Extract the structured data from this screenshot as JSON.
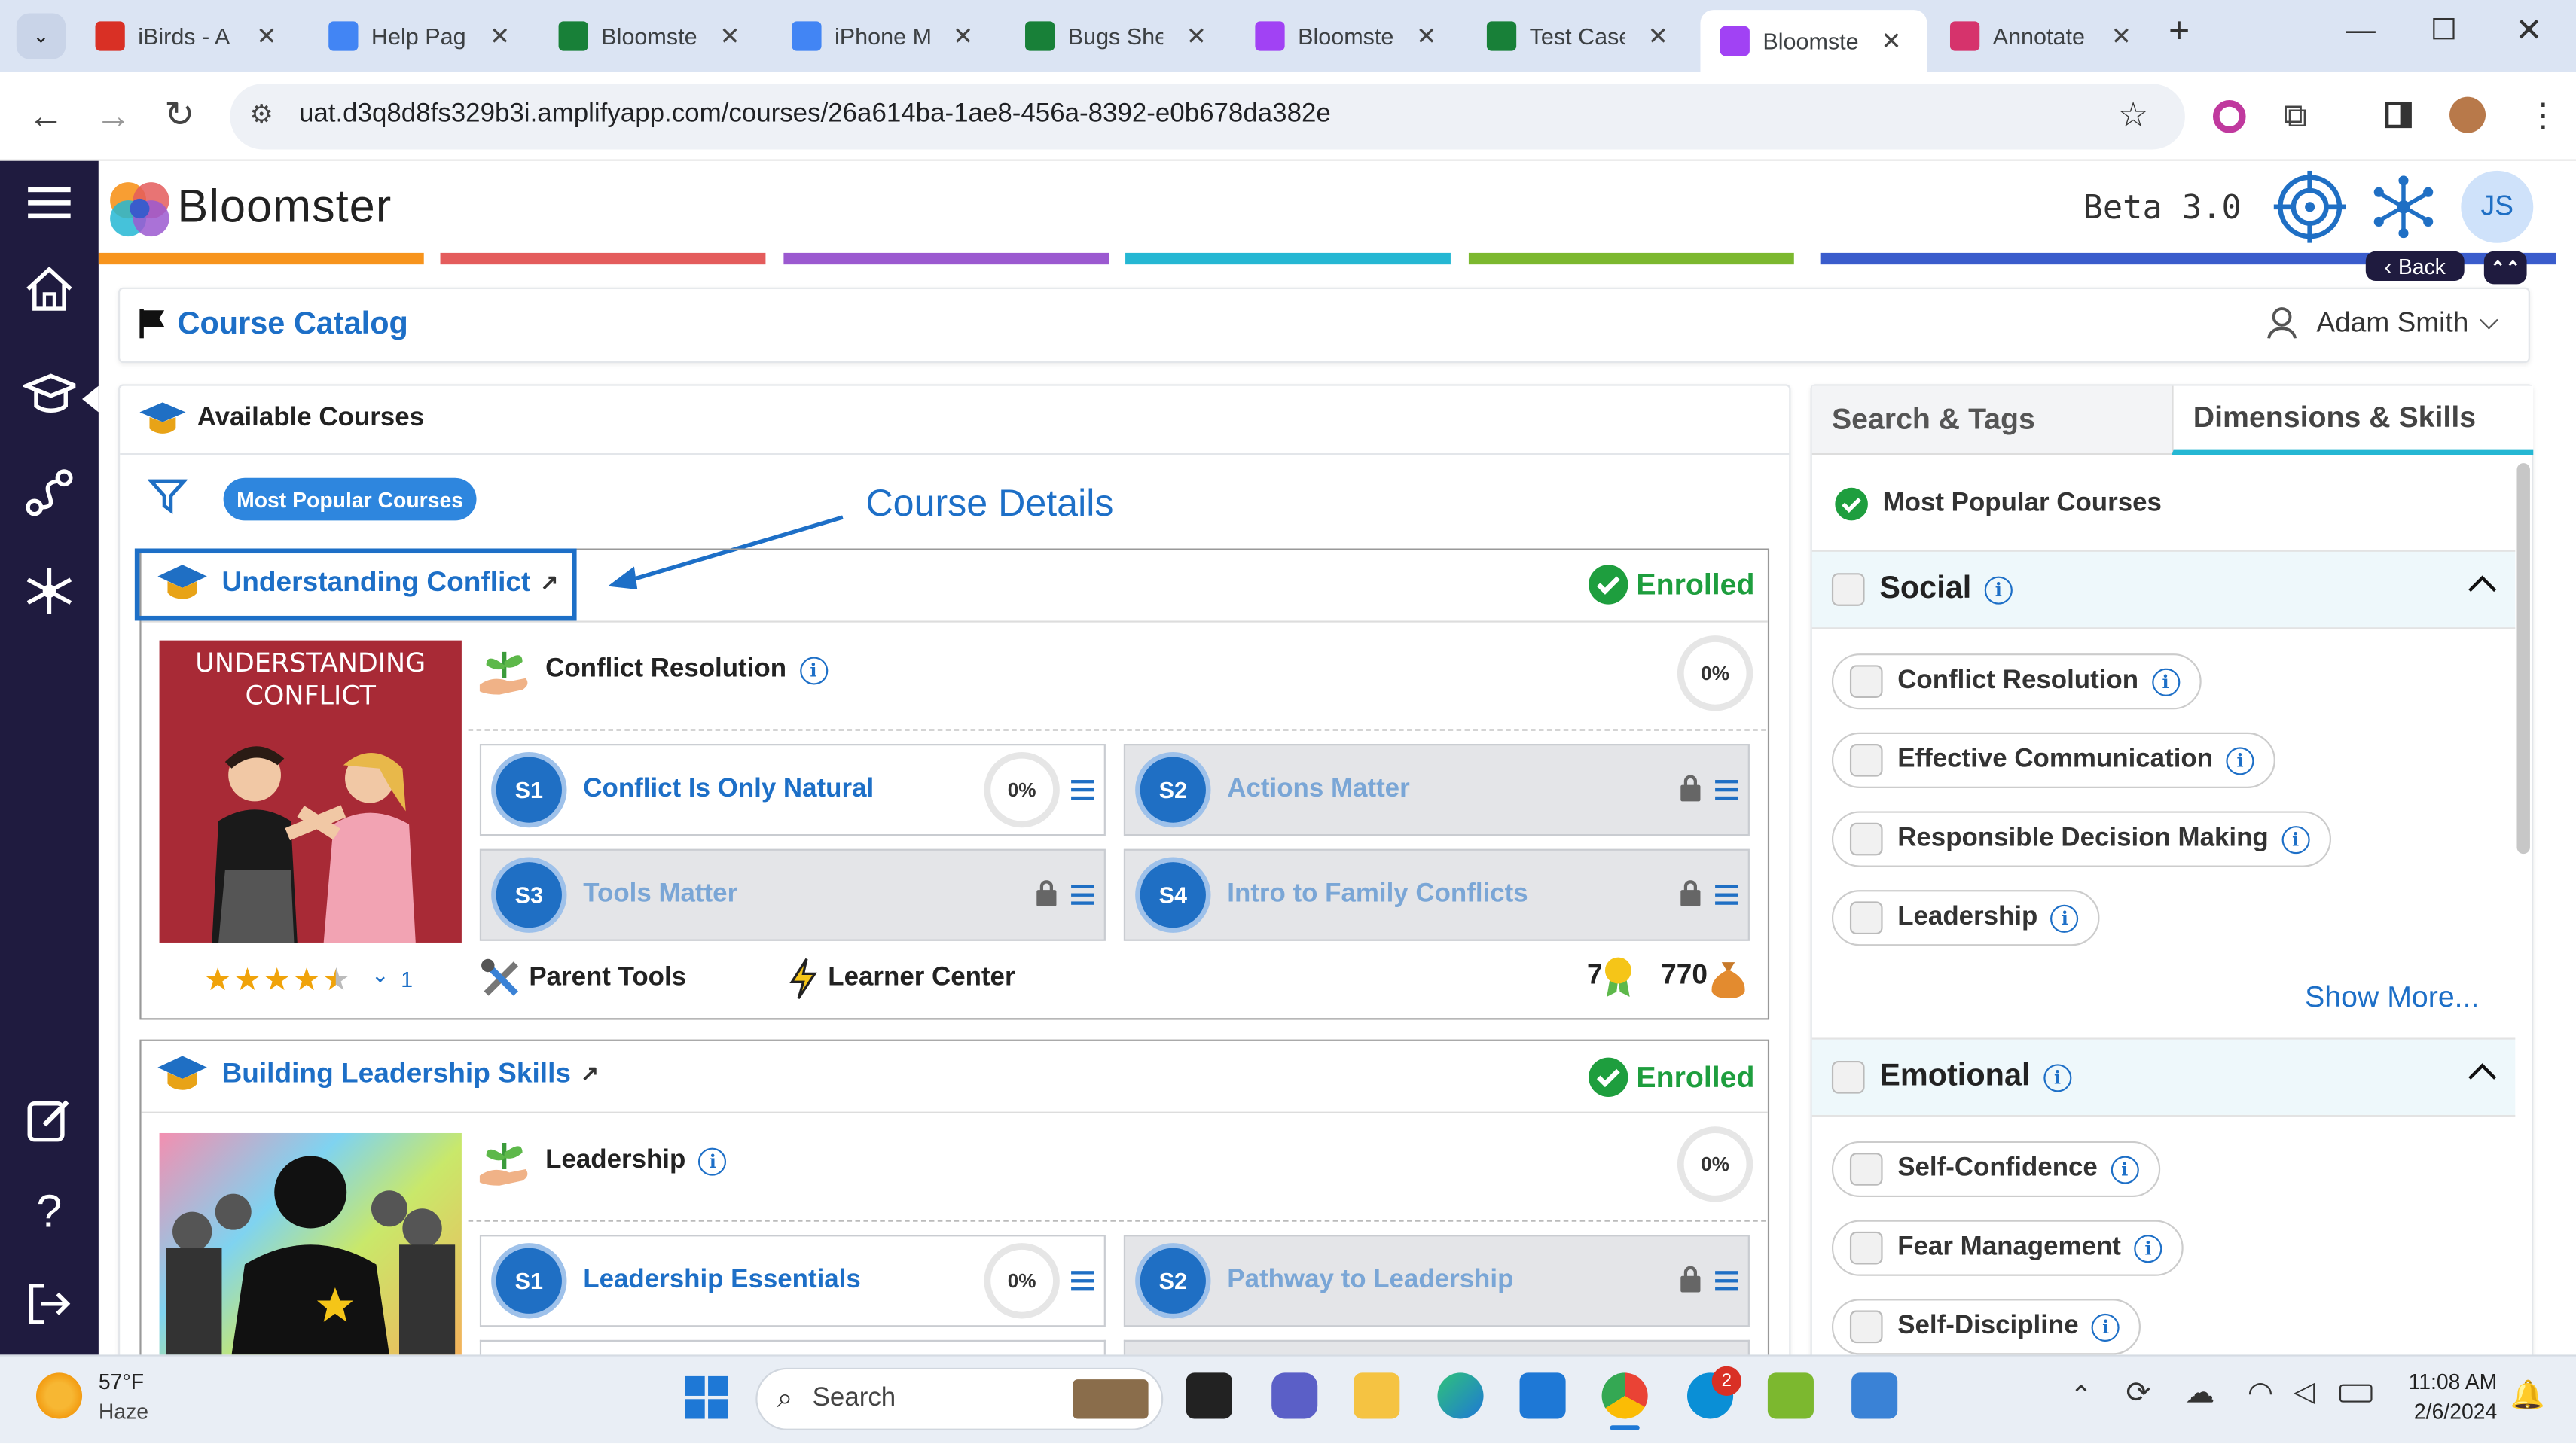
{
  "browser": {
    "tabs": [
      {
        "label": "iBirds - A",
        "color": "#d93025"
      },
      {
        "label": "Help Page",
        "color": "#4285f4"
      },
      {
        "label": "Bloomster",
        "color": "#188038"
      },
      {
        "label": "iPhone M",
        "color": "#4285f4"
      },
      {
        "label": "Bugs Shee",
        "color": "#188038"
      },
      {
        "label": "Bloomster",
        "color": "#a142f4"
      },
      {
        "label": "Test Case",
        "color": "#188038"
      },
      {
        "label": "Bloomster",
        "color": "#a142f4"
      },
      {
        "label": "Annotate",
        "color": "#d6336c"
      }
    ],
    "active_tab": 7,
    "url": "uat.d3q8d8fs329b3i.amplifyapp.com/courses/26a614ba-1ae8-456a-8392-e0b678da382e"
  },
  "app": {
    "brand": "Bloomster",
    "version": "Beta 3.0",
    "avatar_initials": "JS",
    "back_label": "Back",
    "color_bar": [
      "#f7941d",
      "#e45c5c",
      "#9b59d0",
      "#25b7d3",
      "#7cb82f",
      "#3a5ccc"
    ]
  },
  "catalog": {
    "title": "Course Catalog",
    "user": "Adam Smith",
    "available_title": "Available Courses",
    "filter_pill": "Most Popular Courses",
    "annotation": "Course Details"
  },
  "courses": [
    {
      "title": "Understanding Conflict",
      "status": "Enrolled",
      "cover_text": "UNDERSTANDING CONFLICT",
      "skill": "Conflict Resolution",
      "progress": "0%",
      "rating": 4.5,
      "rating_count": "1",
      "parent_tools": "Parent Tools",
      "learner_center": "Learner Center",
      "medals": "7",
      "coins": "770",
      "sessions": [
        {
          "code": "S1",
          "name": "Conflict Is Only Natural",
          "progress": "0%",
          "locked": false
        },
        {
          "code": "S2",
          "name": "Actions Matter",
          "locked": true
        },
        {
          "code": "S3",
          "name": "Tools Matter",
          "locked": true
        },
        {
          "code": "S4",
          "name": "Intro to Family Conflicts",
          "locked": true
        }
      ]
    },
    {
      "title": "Building Leadership Skills",
      "status": "Enrolled",
      "skill": "Leadership",
      "progress": "0%",
      "sessions": [
        {
          "code": "S1",
          "name": "Leadership Essentials",
          "progress": "0%",
          "locked": false
        },
        {
          "code": "S2",
          "name": "Pathway to Leadership",
          "locked": true
        }
      ]
    }
  ],
  "panel": {
    "tabs": [
      "Search & Tags",
      "Dimensions & Skills"
    ],
    "active_tab": 1,
    "selected": "Most Popular Courses",
    "social": {
      "label": "Social",
      "items": [
        "Conflict Resolution",
        "Effective Communication",
        "Responsible Decision Making",
        "Leadership"
      ],
      "show_more": "Show More..."
    },
    "emotional": {
      "label": "Emotional",
      "items": [
        "Self-Confidence",
        "Fear Management",
        "Self-Discipline"
      ]
    }
  },
  "taskbar": {
    "weather_temp": "57°F",
    "weather_desc": "Haze",
    "search": "Search",
    "time": "11:08 AM",
    "date": "2/6/2024",
    "skype_badge": "2"
  }
}
